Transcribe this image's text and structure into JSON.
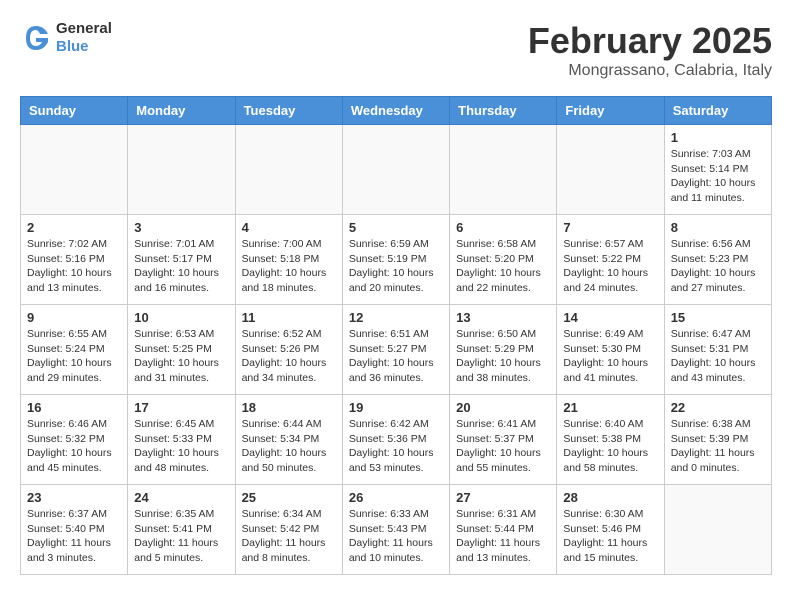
{
  "logo": {
    "general": "General",
    "blue": "Blue"
  },
  "title": "February 2025",
  "location": "Mongrassano, Calabria, Italy",
  "weekdays": [
    "Sunday",
    "Monday",
    "Tuesday",
    "Wednesday",
    "Thursday",
    "Friday",
    "Saturday"
  ],
  "weeks": [
    [
      {
        "day": "",
        "info": ""
      },
      {
        "day": "",
        "info": ""
      },
      {
        "day": "",
        "info": ""
      },
      {
        "day": "",
        "info": ""
      },
      {
        "day": "",
        "info": ""
      },
      {
        "day": "",
        "info": ""
      },
      {
        "day": "1",
        "info": "Sunrise: 7:03 AM\nSunset: 5:14 PM\nDaylight: 10 hours\nand 11 minutes."
      }
    ],
    [
      {
        "day": "2",
        "info": "Sunrise: 7:02 AM\nSunset: 5:16 PM\nDaylight: 10 hours\nand 13 minutes."
      },
      {
        "day": "3",
        "info": "Sunrise: 7:01 AM\nSunset: 5:17 PM\nDaylight: 10 hours\nand 16 minutes."
      },
      {
        "day": "4",
        "info": "Sunrise: 7:00 AM\nSunset: 5:18 PM\nDaylight: 10 hours\nand 18 minutes."
      },
      {
        "day": "5",
        "info": "Sunrise: 6:59 AM\nSunset: 5:19 PM\nDaylight: 10 hours\nand 20 minutes."
      },
      {
        "day": "6",
        "info": "Sunrise: 6:58 AM\nSunset: 5:20 PM\nDaylight: 10 hours\nand 22 minutes."
      },
      {
        "day": "7",
        "info": "Sunrise: 6:57 AM\nSunset: 5:22 PM\nDaylight: 10 hours\nand 24 minutes."
      },
      {
        "day": "8",
        "info": "Sunrise: 6:56 AM\nSunset: 5:23 PM\nDaylight: 10 hours\nand 27 minutes."
      }
    ],
    [
      {
        "day": "9",
        "info": "Sunrise: 6:55 AM\nSunset: 5:24 PM\nDaylight: 10 hours\nand 29 minutes."
      },
      {
        "day": "10",
        "info": "Sunrise: 6:53 AM\nSunset: 5:25 PM\nDaylight: 10 hours\nand 31 minutes."
      },
      {
        "day": "11",
        "info": "Sunrise: 6:52 AM\nSunset: 5:26 PM\nDaylight: 10 hours\nand 34 minutes."
      },
      {
        "day": "12",
        "info": "Sunrise: 6:51 AM\nSunset: 5:27 PM\nDaylight: 10 hours\nand 36 minutes."
      },
      {
        "day": "13",
        "info": "Sunrise: 6:50 AM\nSunset: 5:29 PM\nDaylight: 10 hours\nand 38 minutes."
      },
      {
        "day": "14",
        "info": "Sunrise: 6:49 AM\nSunset: 5:30 PM\nDaylight: 10 hours\nand 41 minutes."
      },
      {
        "day": "15",
        "info": "Sunrise: 6:47 AM\nSunset: 5:31 PM\nDaylight: 10 hours\nand 43 minutes."
      }
    ],
    [
      {
        "day": "16",
        "info": "Sunrise: 6:46 AM\nSunset: 5:32 PM\nDaylight: 10 hours\nand 45 minutes."
      },
      {
        "day": "17",
        "info": "Sunrise: 6:45 AM\nSunset: 5:33 PM\nDaylight: 10 hours\nand 48 minutes."
      },
      {
        "day": "18",
        "info": "Sunrise: 6:44 AM\nSunset: 5:34 PM\nDaylight: 10 hours\nand 50 minutes."
      },
      {
        "day": "19",
        "info": "Sunrise: 6:42 AM\nSunset: 5:36 PM\nDaylight: 10 hours\nand 53 minutes."
      },
      {
        "day": "20",
        "info": "Sunrise: 6:41 AM\nSunset: 5:37 PM\nDaylight: 10 hours\nand 55 minutes."
      },
      {
        "day": "21",
        "info": "Sunrise: 6:40 AM\nSunset: 5:38 PM\nDaylight: 10 hours\nand 58 minutes."
      },
      {
        "day": "22",
        "info": "Sunrise: 6:38 AM\nSunset: 5:39 PM\nDaylight: 11 hours\nand 0 minutes."
      }
    ],
    [
      {
        "day": "23",
        "info": "Sunrise: 6:37 AM\nSunset: 5:40 PM\nDaylight: 11 hours\nand 3 minutes."
      },
      {
        "day": "24",
        "info": "Sunrise: 6:35 AM\nSunset: 5:41 PM\nDaylight: 11 hours\nand 5 minutes."
      },
      {
        "day": "25",
        "info": "Sunrise: 6:34 AM\nSunset: 5:42 PM\nDaylight: 11 hours\nand 8 minutes."
      },
      {
        "day": "26",
        "info": "Sunrise: 6:33 AM\nSunset: 5:43 PM\nDaylight: 11 hours\nand 10 minutes."
      },
      {
        "day": "27",
        "info": "Sunrise: 6:31 AM\nSunset: 5:44 PM\nDaylight: 11 hours\nand 13 minutes."
      },
      {
        "day": "28",
        "info": "Sunrise: 6:30 AM\nSunset: 5:46 PM\nDaylight: 11 hours\nand 15 minutes."
      },
      {
        "day": "",
        "info": ""
      }
    ]
  ]
}
